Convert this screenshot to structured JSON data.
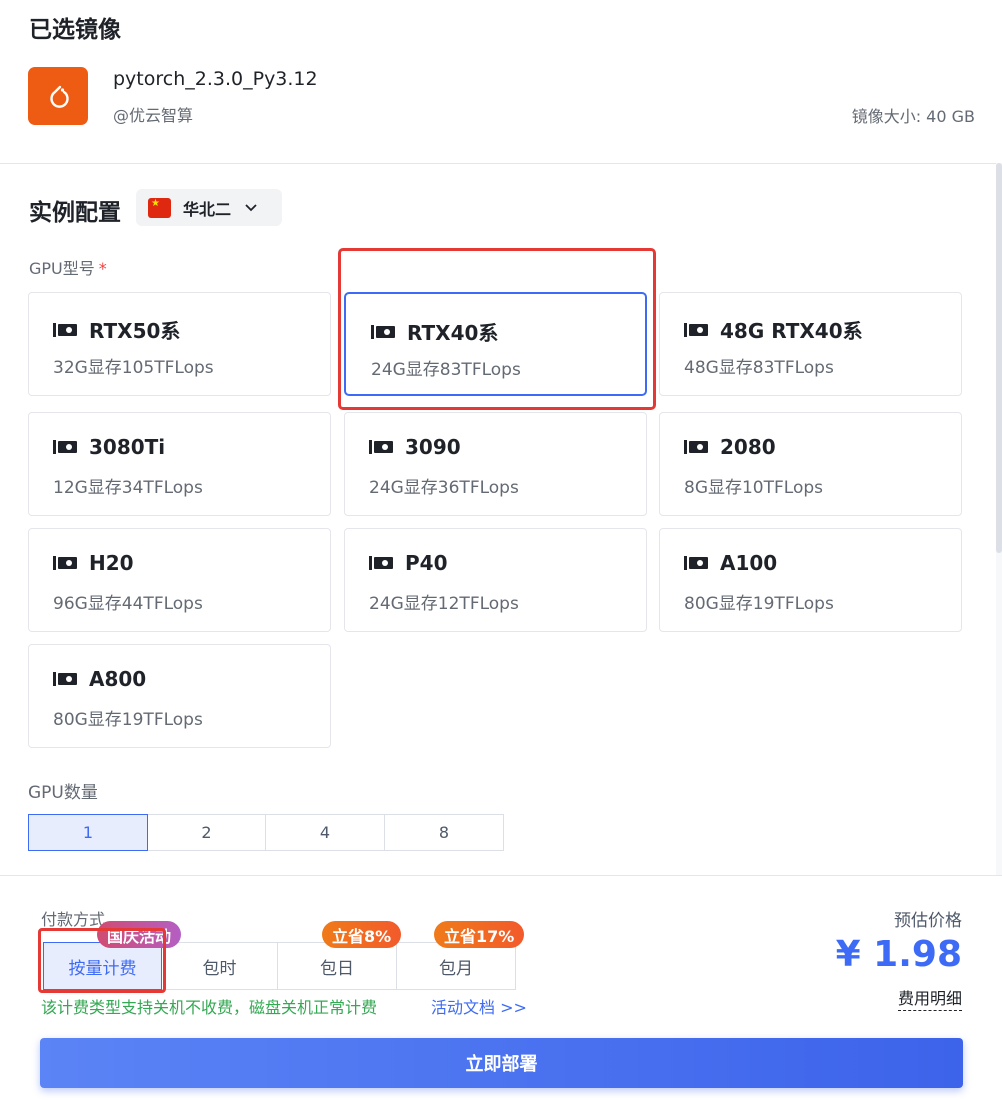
{
  "selected_image": {
    "title": "已选镜像",
    "name": "pytorch_2.3.0_Py3.12",
    "owner": "@优云智算",
    "size_text": "镜像大小: 40 GB"
  },
  "instance_config": {
    "title": "实例配置",
    "region": "华北二",
    "gpu_type_label": "GPU型号",
    "required_mark": "*",
    "gpu_types": [
      {
        "name": "RTX50系",
        "spec": "32G显存105TFLops",
        "selected": false
      },
      {
        "name": "RTX40系",
        "spec": "24G显存83TFLops",
        "selected": true
      },
      {
        "name": "48G RTX40系",
        "spec": "48G显存83TFLops",
        "selected": false
      },
      {
        "name": "3080Ti",
        "spec": "12G显存34TFLops",
        "selected": false
      },
      {
        "name": "3090",
        "spec": "24G显存36TFLops",
        "selected": false
      },
      {
        "name": "2080",
        "spec": "8G显存10TFLops",
        "selected": false
      },
      {
        "name": "H20",
        "spec": "96G显存44TFLops",
        "selected": false
      },
      {
        "name": "P40",
        "spec": "24G显存12TFLops",
        "selected": false
      },
      {
        "name": "A100",
        "spec": "80G显存19TFLops",
        "selected": false
      },
      {
        "name": "A800",
        "spec": "80G显存19TFLops",
        "selected": false
      }
    ],
    "gpu_count_label": "GPU数量",
    "gpu_counts": [
      "1",
      "2",
      "4",
      "8"
    ],
    "gpu_count_selected": "1"
  },
  "payment": {
    "label": "付款方式",
    "options": [
      {
        "label": "按量计费",
        "badge": "国庆活动",
        "active": true
      },
      {
        "label": "包时",
        "badge": "",
        "active": false
      },
      {
        "label": "包日",
        "badge": "立省8%",
        "active": false
      },
      {
        "label": "包月",
        "badge": "立省17%",
        "active": false
      }
    ],
    "note": "该计费类型支持关机不收费，磁盘关机正常计费",
    "note_link": "活动文档 >>"
  },
  "price": {
    "label": "预估价格",
    "value": "¥ 1.98",
    "detail_link": "费用明细"
  },
  "deploy_button": "立即部署",
  "colors": {
    "accent": "#3e6bf5",
    "highlight_red": "#e53935",
    "logo_orange": "#ee5b12",
    "note_green": "#34a853"
  }
}
